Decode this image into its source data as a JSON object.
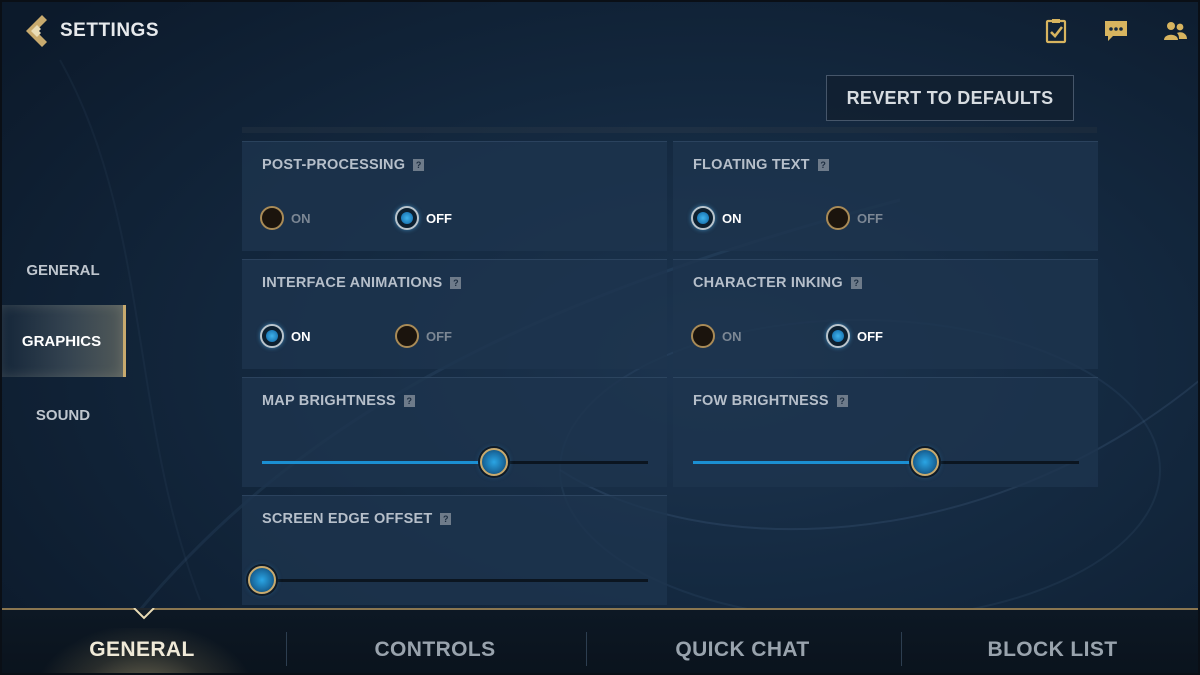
{
  "header": {
    "title": "SETTINGS",
    "icons": [
      "clipboard-check-icon",
      "chat-bubble-icon",
      "friends-icon"
    ]
  },
  "toolbar": {
    "revert_label": "REVERT TO DEFAULTS"
  },
  "left_nav": {
    "items": [
      {
        "label": "GENERAL",
        "active": false
      },
      {
        "label": "GRAPHICS",
        "active": true
      },
      {
        "label": "SOUND",
        "active": false
      }
    ]
  },
  "settings": {
    "post_processing": {
      "label": "POST-PROCESSING",
      "on_label": "ON",
      "off_label": "OFF",
      "value": "OFF"
    },
    "floating_text": {
      "label": "FLOATING TEXT",
      "on_label": "ON",
      "off_label": "OFF",
      "value": "ON"
    },
    "interface_animations": {
      "label": "INTERFACE ANIMATIONS",
      "on_label": "ON",
      "off_label": "OFF",
      "value": "ON"
    },
    "character_inking": {
      "label": "CHARACTER INKING",
      "on_label": "ON",
      "off_label": "OFF",
      "value": "OFF"
    },
    "map_brightness": {
      "label": "MAP BRIGHTNESS",
      "value_fraction": 0.6
    },
    "fow_brightness": {
      "label": "FOW BRIGHTNESS",
      "value_fraction": 0.6
    },
    "screen_edge_offset": {
      "label": "SCREEN EDGE OFFSET",
      "value_fraction": 0.0
    }
  },
  "bottom_tabs": [
    {
      "label": "GENERAL",
      "active": true
    },
    {
      "label": "CONTROLS",
      "active": false
    },
    {
      "label": "QUICK CHAT",
      "active": false
    },
    {
      "label": "BLOCK LIST",
      "active": false
    }
  ],
  "colors": {
    "accent_gold": "#c8aa6e",
    "accent_blue": "#1b8fd2",
    "background": "#142940"
  }
}
